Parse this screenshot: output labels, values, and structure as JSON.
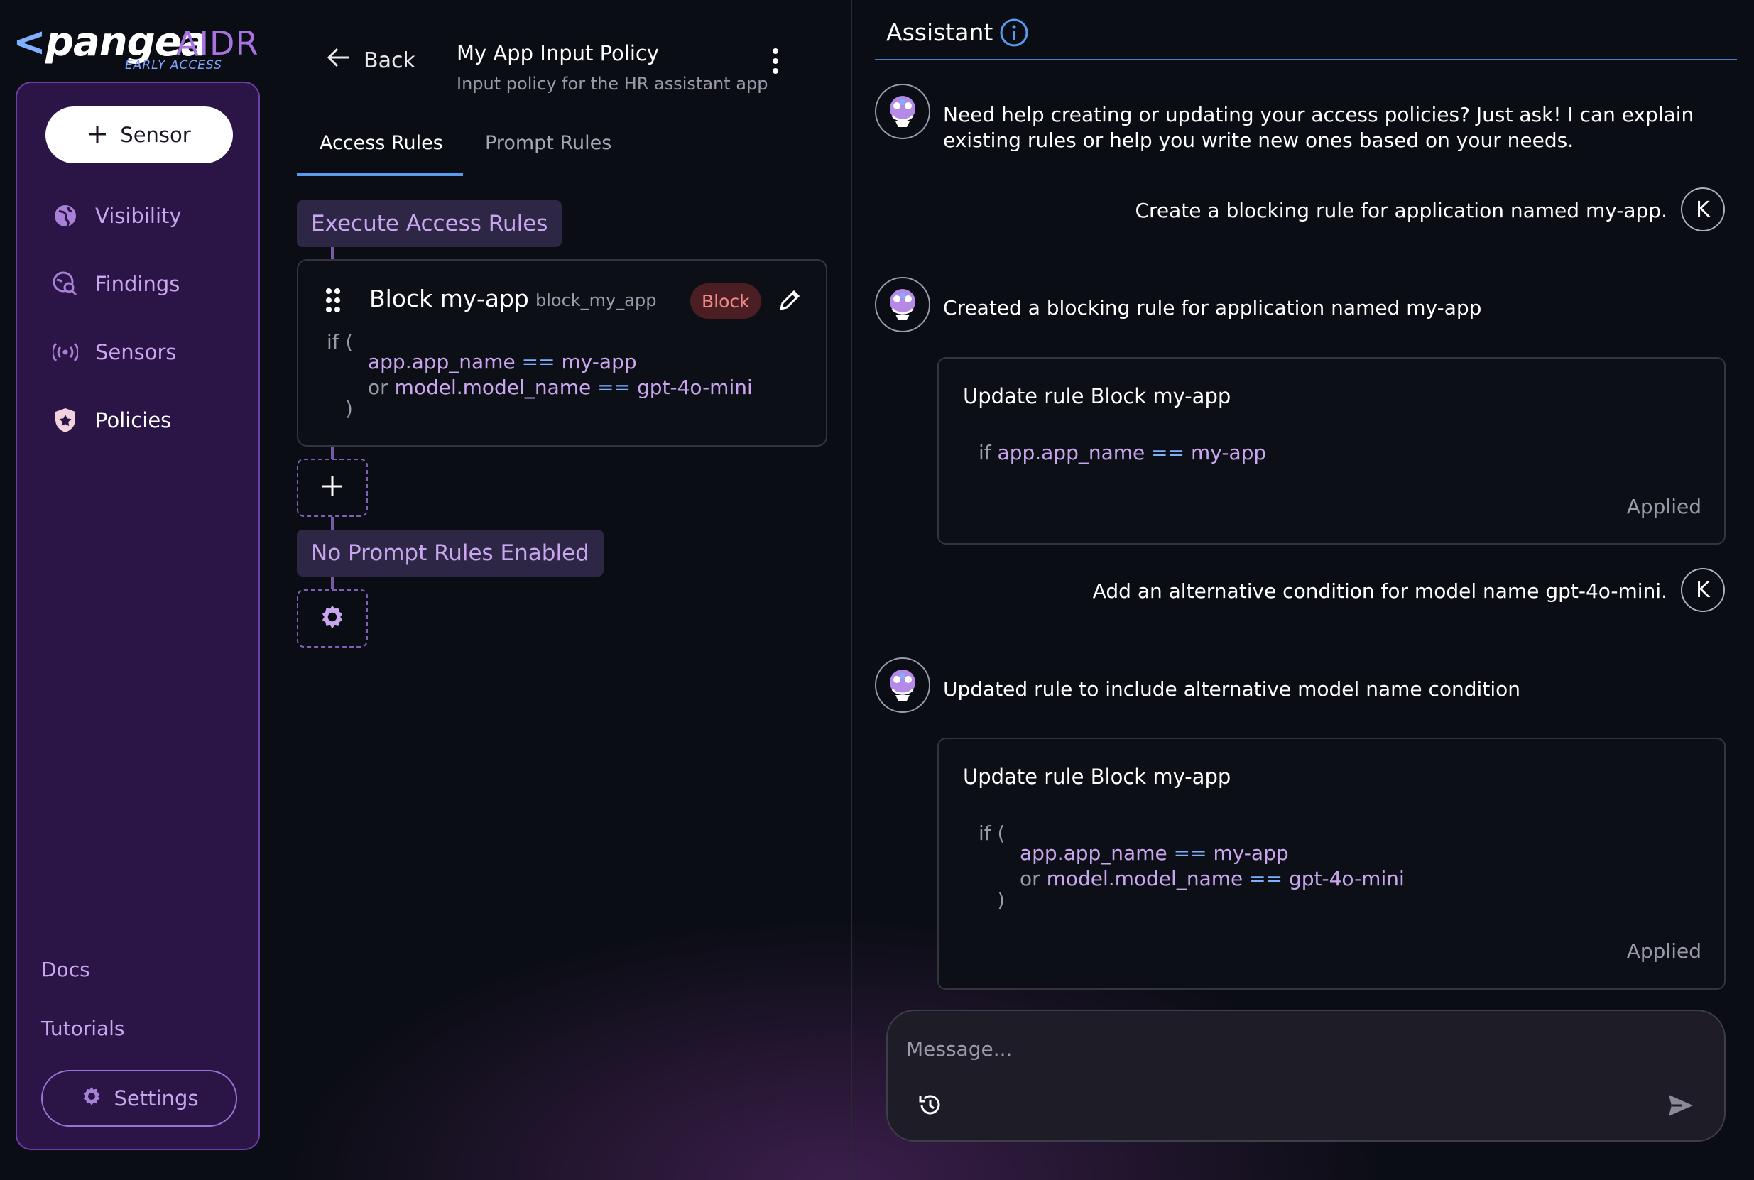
{
  "brand": {
    "chevron": "<",
    "name": "pangea",
    "product": "AIDR",
    "tag": "EARLY ACCESS"
  },
  "sidebar": {
    "sensor_button": "Sensor",
    "items": [
      {
        "label": "Visibility",
        "icon": "globe-icon",
        "active": false
      },
      {
        "label": "Findings",
        "icon": "search-globe-icon",
        "active": false
      },
      {
        "label": "Sensors",
        "icon": "broadcast-icon",
        "active": false
      },
      {
        "label": "Policies",
        "icon": "shield-star-icon",
        "active": true
      }
    ],
    "docs": "Docs",
    "tutorials": "Tutorials",
    "settings": "Settings"
  },
  "policy": {
    "back": "Back",
    "title": "My App Input Policy",
    "subtitle": "Input policy for the HR assistant app",
    "tabs": [
      "Access Rules",
      "Prompt Rules"
    ],
    "execute_chip": "Execute Access Rules",
    "rule": {
      "name": "Block my-app",
      "id": "block_my_app",
      "action": "Block",
      "code": {
        "if_open": "if (",
        "cond1_var": "app.app_name",
        "cond1_op": "==",
        "cond1_val": "my-app",
        "or": "or",
        "cond2_var": "model.model_name",
        "cond2_op": "==",
        "cond2_val": "gpt-4o-mini",
        "close": ")"
      }
    },
    "no_prompt_chip": "No Prompt Rules Enabled"
  },
  "assistant": {
    "title": "Assistant",
    "messages": [
      {
        "role": "bot",
        "text": "Need help creating or updating your access policies? Just ask! I can explain existing rules or help you write new ones based on your needs."
      },
      {
        "role": "user",
        "initial": "K",
        "text": "Create a blocking rule for application named my-app."
      },
      {
        "role": "bot",
        "text": "Created a blocking rule for application named my-app"
      },
      {
        "role": "user",
        "initial": "K",
        "text": "Add an alternative condition for model name gpt-4o-mini."
      },
      {
        "role": "bot",
        "text": "Updated rule to include alternative model name condition"
      }
    ],
    "card1": {
      "title": "Update rule Block my-app",
      "if_kw": "if",
      "var": "app.app_name",
      "op": "==",
      "val": "my-app",
      "status": "Applied"
    },
    "card2": {
      "title": "Update rule Block my-app",
      "if_open": "if (",
      "cond1_var": "app.app_name",
      "cond1_op": "==",
      "cond1_val": "my-app",
      "or": "or",
      "cond2_var": "model.model_name",
      "cond2_op": "==",
      "cond2_val": "gpt-4o-mini",
      "close": ")",
      "status": "Applied"
    },
    "composer": {
      "placeholder": "Message...",
      "value": ""
    }
  },
  "colors": {
    "accent": "#c9a6ef",
    "link_blue": "#5a9bf0",
    "sidebar_bg": "#2a1546",
    "block_badge": "#f08a8a"
  }
}
